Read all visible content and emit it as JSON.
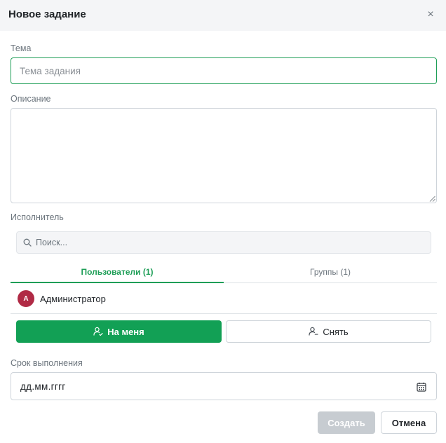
{
  "dialog": {
    "title": "Новое задание",
    "close_glyph": "×"
  },
  "subject": {
    "label": "Тема",
    "placeholder": "Тема задания",
    "value": ""
  },
  "description": {
    "label": "Описание",
    "value": ""
  },
  "assignee": {
    "label": "Исполнитель",
    "search_placeholder": "Поиск...",
    "tabs": [
      {
        "label": "Пользователи (1)",
        "active": true
      },
      {
        "label": "Группы (1)",
        "active": false
      }
    ],
    "users": [
      {
        "initial": "A",
        "name": "Администратор",
        "avatar_color": "#b02a45"
      }
    ],
    "assign_me_label": "На меня",
    "remove_label": "Снять"
  },
  "due_date": {
    "label": "Срок выполнения",
    "placeholder": "дд.мм.гггг"
  },
  "footer": {
    "create_label": "Создать",
    "cancel_label": "Отмена"
  },
  "colors": {
    "accent": "#12a055",
    "focus_border": "#1e9e57",
    "disabled_button": "#c7ccd1"
  },
  "icons": {
    "close": "close-icon",
    "search": "search-icon",
    "user_check": "user-check-icon",
    "user_minus": "user-minus-icon",
    "calendar": "calendar-icon",
    "resize_grip": "resize-grip-icon"
  }
}
